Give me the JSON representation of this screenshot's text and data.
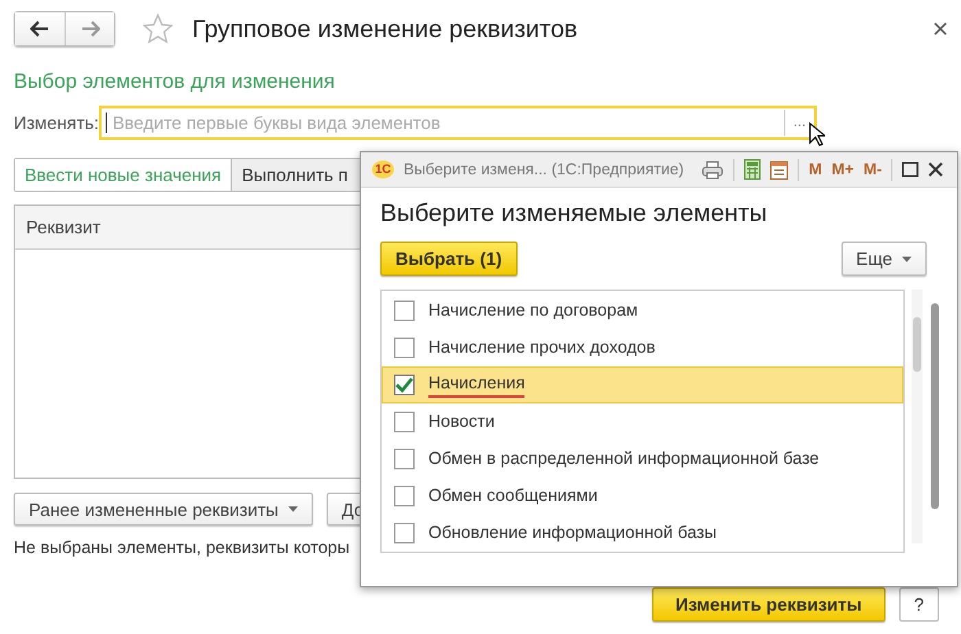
{
  "window": {
    "title": "Групповое изменение реквизитов"
  },
  "section_title": "Выбор элементов для изменения",
  "change_field": {
    "label": "Изменять:",
    "placeholder": "Введите первые буквы вида элементов",
    "button": "..."
  },
  "tabs": [
    {
      "label": "Ввести новые значения",
      "selected": true
    },
    {
      "label": "Выполнить п",
      "selected": false
    }
  ],
  "table": {
    "columns": [
      "Реквизит"
    ]
  },
  "buttons": [
    {
      "label": "Ранее измененные реквизиты",
      "dropdown": true
    },
    {
      "label": "До",
      "dropdown": false
    }
  ],
  "status_text": "Не выбраны элементы, реквизиты которы",
  "footer_buttons": [
    {
      "label": "Изменить реквизиты",
      "kind": "primary"
    },
    {
      "label": "?",
      "kind": "plain"
    }
  ],
  "dialog": {
    "window_title": "Выберите изменя... (1С:Предприятие)",
    "logo": "1С",
    "memory_buttons": [
      "M",
      "M+",
      "M-"
    ],
    "heading": "Выберите изменяемые элементы",
    "select_button": "Выбрать (1)",
    "more_button": "Еще",
    "items": [
      {
        "label": "Начисление по договорам",
        "checked": false,
        "selected": false
      },
      {
        "label": "Начисление прочих доходов",
        "checked": false,
        "selected": false
      },
      {
        "label": "Начисления",
        "checked": true,
        "selected": true
      },
      {
        "label": "Новости",
        "checked": false,
        "selected": false
      },
      {
        "label": "Обмен в распределенной информационной базе",
        "checked": false,
        "selected": false
      },
      {
        "label": "Обмен сообщениями",
        "checked": false,
        "selected": false
      },
      {
        "label": "Обновление информационной базы",
        "checked": false,
        "selected": false
      }
    ]
  }
}
